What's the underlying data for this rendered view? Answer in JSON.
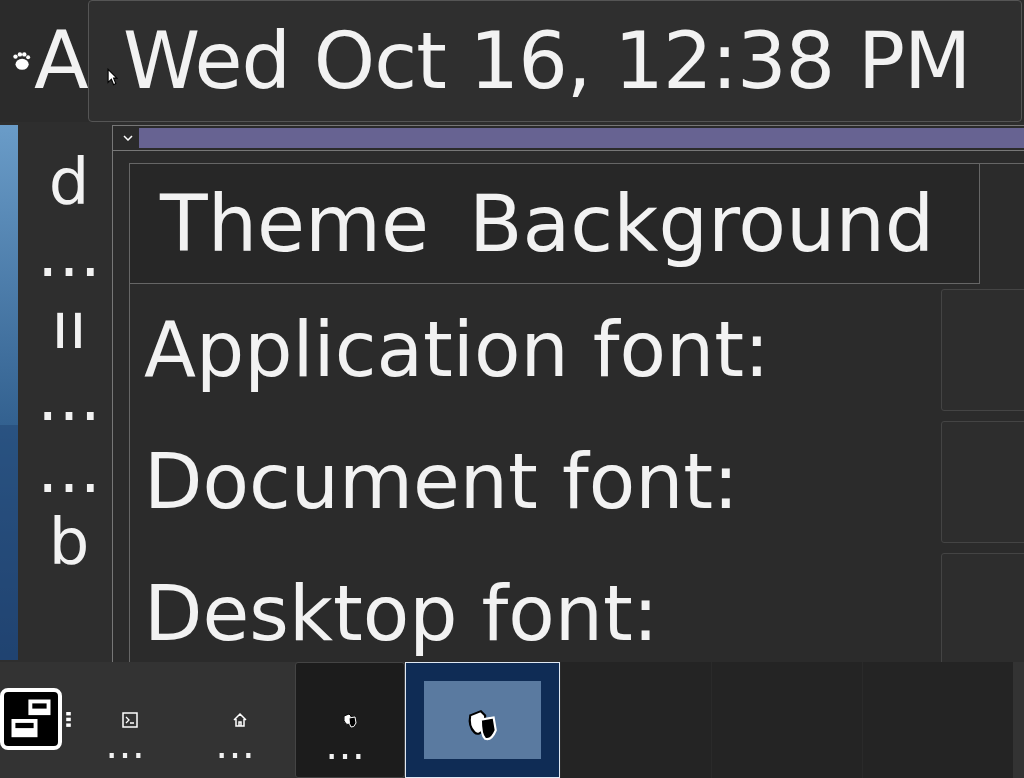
{
  "top_panel": {
    "app_menu_label": "A",
    "clock": "Wed Oct 16, 12:38 PM"
  },
  "desktop_texts": [
    "d",
    "…",
    "ıı",
    "…",
    "…",
    "b"
  ],
  "window": {
    "tabs": [
      {
        "label": "Theme"
      },
      {
        "label": "Background"
      }
    ],
    "rows": [
      {
        "label": "Application font:"
      },
      {
        "label": "Document font:"
      },
      {
        "label": "Desktop font:"
      }
    ]
  },
  "taskbar": {
    "launchers": [
      {
        "kind": "terminal",
        "label": "…"
      },
      {
        "kind": "home",
        "label": "…"
      },
      {
        "kind": "shield",
        "label": "…"
      }
    ],
    "tasks": [
      {
        "selected": true
      },
      {
        "selected": false
      },
      {
        "selected": false
      },
      {
        "selected": false
      }
    ]
  }
}
